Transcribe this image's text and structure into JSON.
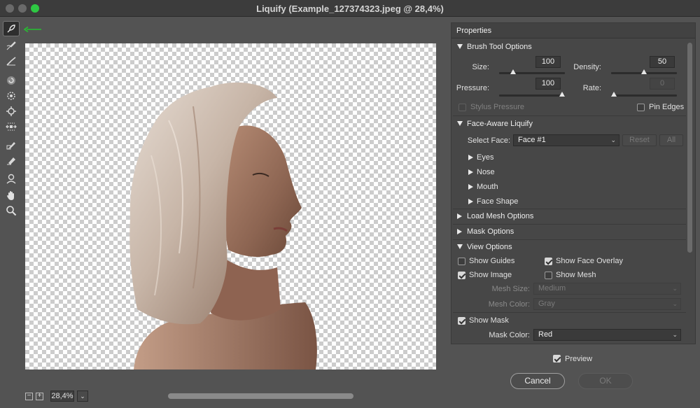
{
  "window": {
    "title": "Liquify (Example_127374323.jpeg @ 28,4%)"
  },
  "toolbar": {
    "tools": [
      "forward-warp-icon",
      "reconstruct-icon",
      "smooth-icon",
      "twirl-icon",
      "pucker-icon",
      "bloat-icon",
      "push-left-icon",
      "freeze-mask-icon",
      "thaw-mask-icon",
      "face-tool-icon",
      "hand-icon",
      "zoom-icon"
    ],
    "active_tool": "forward-warp-icon",
    "indicator_color": "#25c22f"
  },
  "status": {
    "zoom": "28,4%"
  },
  "properties": {
    "title": "Properties",
    "brush": {
      "heading": "Brush Tool Options",
      "size_label": "Size:",
      "size": "100",
      "density_label": "Density:",
      "density": "50",
      "pressure_label": "Pressure:",
      "pressure": "100",
      "rate_label": "Rate:",
      "rate": "0",
      "stylus_label": "Stylus Pressure",
      "pin_label": "Pin Edges"
    },
    "face": {
      "heading": "Face-Aware Liquify",
      "select_label": "Select Face:",
      "select_value": "Face #1",
      "reset": "Reset",
      "all": "All",
      "items": [
        "Eyes",
        "Nose",
        "Mouth",
        "Face Shape"
      ]
    },
    "load_mesh": "Load Mesh Options",
    "mask_options": "Mask Options",
    "view": {
      "heading": "View Options",
      "show_guides": "Show Guides",
      "show_face_overlay": "Show Face Overlay",
      "show_image": "Show Image",
      "show_mesh": "Show Mesh",
      "mesh_size_label": "Mesh Size:",
      "mesh_size": "Medium",
      "mesh_color_label": "Mesh Color:",
      "mesh_color": "Gray",
      "show_mask": "Show Mask",
      "mask_color_label": "Mask Color:",
      "mask_color": "Red"
    }
  },
  "footer": {
    "preview": "Preview",
    "cancel": "Cancel",
    "ok": "OK"
  }
}
